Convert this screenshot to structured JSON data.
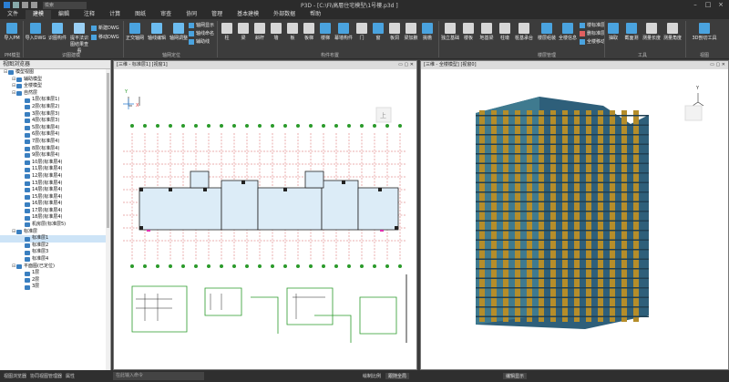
{
  "titlebar": {
    "title": "P3D - [C:\\Fi\\高層住宅模型\\1号樓.p3d ]",
    "search_value": "檢索"
  },
  "menu": [
    "文件",
    "建模",
    "編輯",
    "注释",
    "计算",
    "图纸",
    "审查",
    "协同",
    "管理",
    "基本建模",
    "外部数据",
    "帮助"
  ],
  "ribbon": {
    "pm": {
      "label": "导入PM",
      "group": "PM模型"
    },
    "dwg": {
      "items": [
        "导入DWG",
        "识图构件",
        "提平法识图结果查看"
      ],
      "small": [
        "新建DWG",
        "移动DWG"
      ],
      "group": "识图建模"
    },
    "axis": {
      "items": [
        "正交轴网",
        "轴线编辑",
        "轴网调整"
      ],
      "small": [
        "轴网显示",
        "轴线命名",
        "辅助线"
      ],
      "group": "轴网定位"
    },
    "members": {
      "items": [
        "柱",
        "梁",
        "斜杆",
        "墙",
        "板",
        "板梯",
        "楼梯",
        "幕墙构件",
        "门",
        "窗",
        "板洞",
        "梁加腋",
        "挑檐"
      ],
      "group": "构件布置"
    },
    "floor": {
      "items": [
        "独立基础",
        "楼板",
        "地基梁",
        "柱墩",
        "桩基承台",
        "楼层组装",
        "全楼信息"
      ],
      "small": [
        "楼标准层",
        "删标准层",
        "全楼移动"
      ],
      "group": "楼层管理"
    },
    "tools": {
      "items": [
        "抽取",
        "截面测",
        "测量长度",
        "测量角度"
      ],
      "group": "工具"
    },
    "view": {
      "items": [
        "3D剖切工具"
      ],
      "group": "视图"
    }
  },
  "browser": {
    "title": "视图浏览器",
    "nodes": [
      {
        "label": "模型视图",
        "level": 0
      },
      {
        "label": "辅助模型",
        "level": 1
      },
      {
        "label": "全楼模型",
        "level": 1
      },
      {
        "label": "自然层",
        "level": 1
      },
      {
        "label": "1层(标准层1)",
        "level": 2
      },
      {
        "label": "2层(标准层2)",
        "level": 2
      },
      {
        "label": "3层(标准层3)",
        "level": 2
      },
      {
        "label": "4层(标准层3)",
        "level": 2
      },
      {
        "label": "5层(标准层4)",
        "level": 2
      },
      {
        "label": "6层(标准层4)",
        "level": 2
      },
      {
        "label": "7层(标准层4)",
        "level": 2
      },
      {
        "label": "8层(标准层4)",
        "level": 2
      },
      {
        "label": "9层(标准层4)",
        "level": 2
      },
      {
        "label": "10层(标准层4)",
        "level": 2
      },
      {
        "label": "11层(标准层4)",
        "level": 2
      },
      {
        "label": "12层(标准层4)",
        "level": 2
      },
      {
        "label": "13层(标准层4)",
        "level": 2
      },
      {
        "label": "14层(标准层4)",
        "level": 2
      },
      {
        "label": "15层(标准层4)",
        "level": 2
      },
      {
        "label": "16层(标准层4)",
        "level": 2
      },
      {
        "label": "17层(标准层4)",
        "level": 2
      },
      {
        "label": "18层(标准层4)",
        "level": 2
      },
      {
        "label": "机房层(标准层5)",
        "level": 2
      },
      {
        "label": "标准层",
        "level": 1
      },
      {
        "label": "标准层1",
        "level": 2,
        "selected": true
      },
      {
        "label": "标准层2",
        "level": 2
      },
      {
        "label": "标准层3",
        "level": 2
      },
      {
        "label": "标准层4",
        "level": 2
      },
      {
        "label": "平面图(已定位)",
        "level": 1
      },
      {
        "label": "1层",
        "level": 2
      },
      {
        "label": "2层",
        "level": 2
      },
      {
        "label": "3层",
        "level": 2
      }
    ]
  },
  "viewports": {
    "plan_title": "[三维 - 标准层1] [视窗1]",
    "plan_view_label": "上",
    "model_title": "[三维 - 全楼模型] [视窗0]"
  },
  "status": {
    "tabs": [
      "视图浏览器",
      "协同视图管理器",
      "属性"
    ],
    "cmd_placeholder": "在此输入命令",
    "scale_label": "绘制比例",
    "scale_value": "跟随全局",
    "view_label": "编辑显示"
  },
  "colors": {
    "accent": "#2b7fd4",
    "selected": "#cde4f7",
    "model_facade": "#b58d2a",
    "model_column": "#2e5f7a"
  }
}
